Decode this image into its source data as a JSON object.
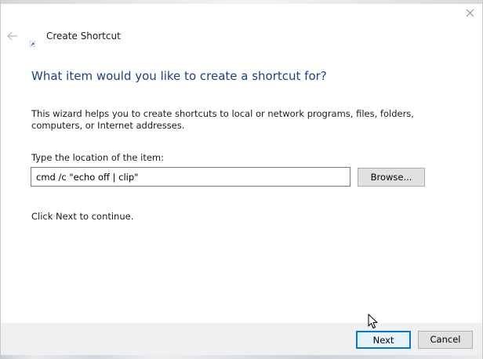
{
  "window": {
    "title": "Create Shortcut"
  },
  "main": {
    "heading": "What item would you like to create a shortcut for?",
    "description": "This wizard helps you to create shortcuts to local or network programs, files, folders, computers, or Internet addresses.",
    "location_label": "Type the location of the item:",
    "location_value": "cmd /c \"echo off | clip\"",
    "browse_label": "Browse...",
    "continue_text": "Click Next to continue."
  },
  "footer": {
    "next_label": "Next",
    "cancel_label": "Cancel"
  },
  "icons": {
    "close": "close-icon",
    "back": "back-arrow-icon",
    "app": "shortcut-icon",
    "cursor": "mouse-pointer-icon"
  },
  "colors": {
    "heading": "#1e3f8a",
    "default_button_border": "#0078d7",
    "footer_background": "#f0f0f0"
  }
}
